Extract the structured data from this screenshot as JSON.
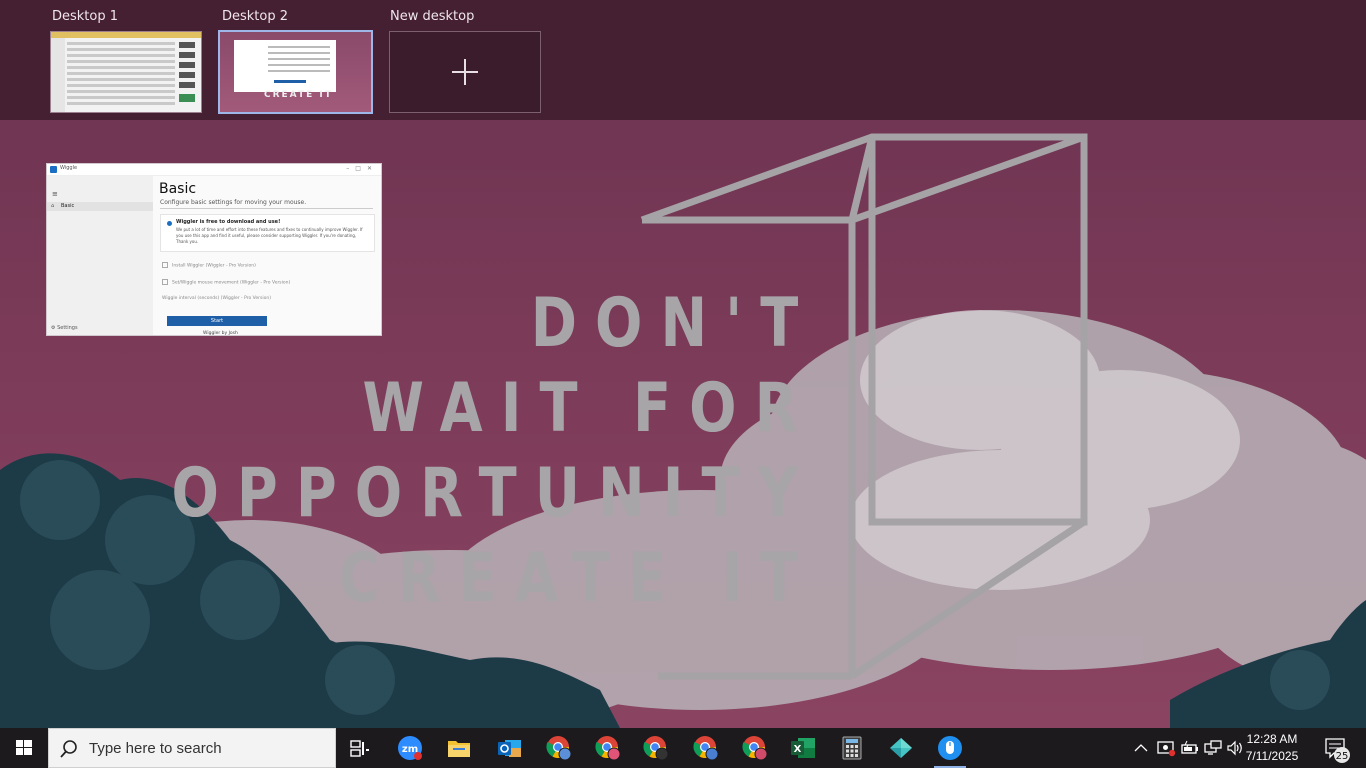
{
  "wallpaper": {
    "quote_lines": [
      "DON'T",
      "WAIT FOR",
      "OPPORTUNITY",
      "CREATE IT"
    ]
  },
  "task_view": {
    "desktops": [
      {
        "label": "Desktop 1"
      },
      {
        "label": "Desktop 2"
      },
      {
        "label": "New desktop"
      }
    ],
    "active_desktop": "Desktop 2",
    "window": {
      "app_name": "Wiggle",
      "nav_item": "Basic",
      "settings_label": "Settings",
      "heading": "Basic",
      "subheading": "Configure basic settings for moving your mouse.",
      "card_title": "Wiggler is free to download and use!",
      "card_text": "We put a lot of time and effort into these features and fixes to continually improve Wiggler. If you use this app and find it useful, please consider supporting Wiggler. If you're donating, Thank you.",
      "option_1": "Install Wiggler (Wiggler - Pro Version)",
      "option_2": "Set/Wiggle mouse movement (Wiggler - Pro Version)",
      "option_3": "Wiggle interval (seconds)  (Wiggler - Pro Version)",
      "start_button": "Start",
      "footer": "Wiggler by Josh"
    }
  },
  "taskbar": {
    "search_placeholder": "Type here to search",
    "icons": [
      "task-view",
      "zoom",
      "file-explorer",
      "outlook",
      "chrome-1",
      "chrome-2",
      "chrome-3",
      "chrome-4",
      "chrome-5",
      "excel",
      "calculator",
      "teams-like",
      "wiggler-mouse"
    ],
    "zoom_label": "zm",
    "clock_time": "12:28 AM",
    "clock_date": "7/11/2025",
    "notification_count": "25"
  }
}
